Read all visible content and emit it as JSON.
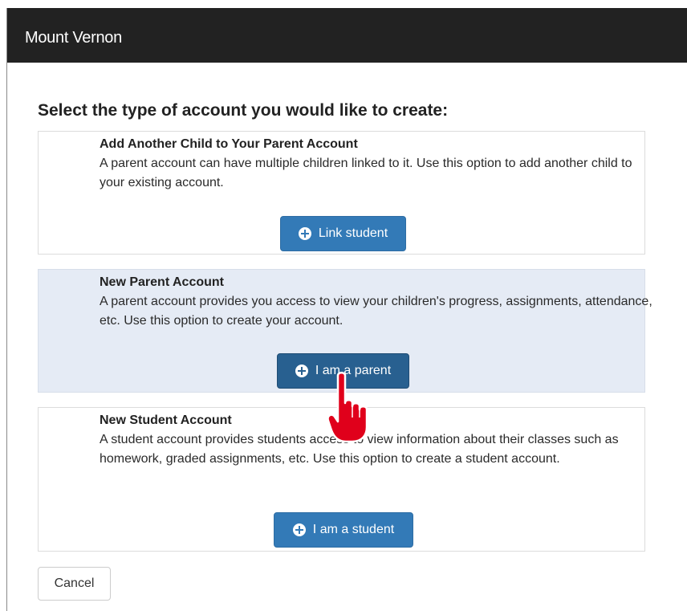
{
  "window": {
    "title": "Mount Vernon"
  },
  "heading": "Select the type of account you would like to create:",
  "options": [
    {
      "title": "Add Another Child to Your Parent Account",
      "description": "A parent account can have multiple children linked to it. Use this option to add another child to your existing account.",
      "button_label": "Link student",
      "button_icon": "plus-circle-icon"
    },
    {
      "title": "New Parent Account",
      "description": "A parent account provides you access to view your children's progress, assignments, attendance, etc. Use this option to create your account.",
      "button_label": "I am a parent",
      "button_icon": "plus-circle-icon"
    },
    {
      "title": "New Student Account",
      "description": "A student account provides students access to view information about their classes such as homework, graded assignments, etc. Use this option to create a student account.",
      "button_label": "I am a student",
      "button_icon": "plus-circle-icon"
    }
  ],
  "cancel_label": "Cancel",
  "colors": {
    "title_bar": "#222222",
    "primary_button": "#337ab7",
    "primary_button_active": "#286090",
    "highlight_panel": "#e5ebf5",
    "cursor": "#e0001b"
  },
  "cursor_icon": "pointing-hand-icon"
}
